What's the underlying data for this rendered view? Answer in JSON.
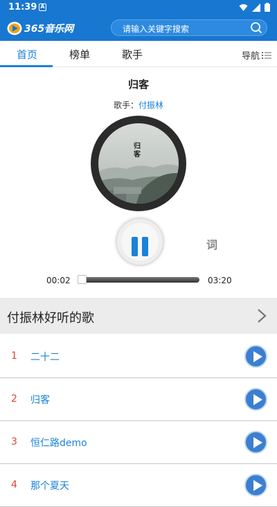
{
  "status_bar": {
    "time": "11:39",
    "notif_letter": "A"
  },
  "header": {
    "logo_text": "365音乐网",
    "logo_sub": "Yue365.com",
    "search_placeholder": "请输入关键字搜索"
  },
  "nav": {
    "tabs": [
      {
        "label": "首页",
        "active": true
      },
      {
        "label": "榜单",
        "active": false
      },
      {
        "label": "歌手",
        "active": false
      }
    ],
    "menu_label": "导航"
  },
  "player": {
    "song_title": "归客",
    "artist_prefix": "歌手：",
    "artist_name": "付振林",
    "album_text": "归客",
    "lyrics_label": "词",
    "current_time": "00:02",
    "total_time": "03:20",
    "progress_fraction": 0.01,
    "state": "playing"
  },
  "section": {
    "title": "付振林好听的歌"
  },
  "songs": [
    {
      "index": "1",
      "name": "二十二"
    },
    {
      "index": "2",
      "name": "归客"
    },
    {
      "index": "3",
      "name": "恒仁路demo"
    },
    {
      "index": "4",
      "name": "那个夏天"
    }
  ],
  "colors": {
    "brand": "#1877d0",
    "accent": "#1a82d8",
    "index_red": "#e0452f",
    "play_button": "#3c7fd0"
  }
}
